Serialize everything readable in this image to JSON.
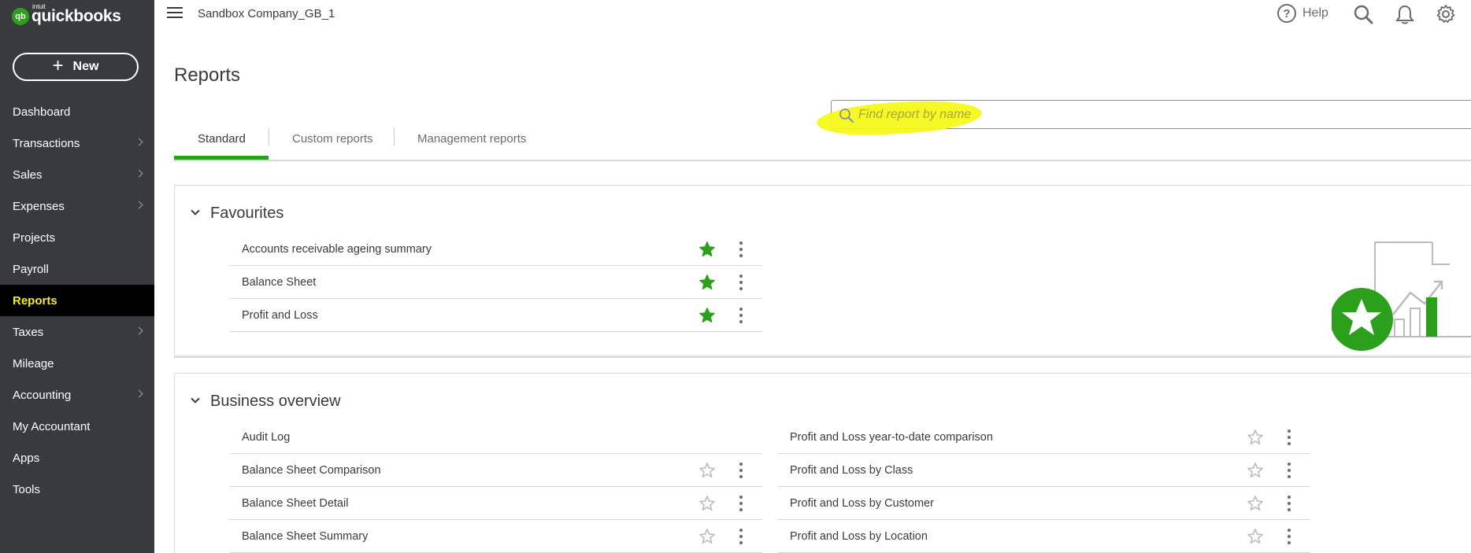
{
  "brand": {
    "badge": "qb",
    "intuit": "intuit",
    "name": "quickbooks",
    "accent": "#2ca01c"
  },
  "sidebar": {
    "new_label": "New",
    "new_plus": "+",
    "items": [
      {
        "label": "Dashboard",
        "chevron": false
      },
      {
        "label": "Transactions",
        "chevron": true
      },
      {
        "label": "Sales",
        "chevron": true
      },
      {
        "label": "Expenses",
        "chevron": true
      },
      {
        "label": "Projects",
        "chevron": false
      },
      {
        "label": "Payroll",
        "chevron": false
      },
      {
        "label": "Reports",
        "chevron": false,
        "active": true
      },
      {
        "label": "Taxes",
        "chevron": true
      },
      {
        "label": "Mileage",
        "chevron": false
      },
      {
        "label": "Accounting",
        "chevron": true
      },
      {
        "label": "My Accountant",
        "chevron": false
      },
      {
        "label": "Apps",
        "chevron": false
      },
      {
        "label": "Tools",
        "chevron": false
      }
    ]
  },
  "topbar": {
    "company": "Sandbox Company_GB_1",
    "help_icon_glyph": "?",
    "help_label": "Help",
    "icons": [
      "search-icon",
      "bell-icon",
      "gear-icon"
    ]
  },
  "page": {
    "title": "Reports"
  },
  "search": {
    "placeholder": "Find report by name"
  },
  "tabs": [
    {
      "label": "Standard",
      "active": true
    },
    {
      "label": "Custom reports",
      "active": false
    },
    {
      "label": "Management reports",
      "active": false
    }
  ],
  "favourites": {
    "title": "Favourites",
    "reports": [
      {
        "name": "Accounts receivable ageing summary",
        "starred": true
      },
      {
        "name": "Balance Sheet",
        "starred": true
      },
      {
        "name": "Profit and Loss",
        "starred": true
      }
    ]
  },
  "business_overview": {
    "title": "Business overview",
    "left": [
      {
        "name": "Audit Log",
        "starred": false,
        "actions": false
      },
      {
        "name": "Balance Sheet Comparison",
        "starred": false,
        "actions": true
      },
      {
        "name": "Balance Sheet Detail",
        "starred": false,
        "actions": true
      },
      {
        "name": "Balance Sheet Summary",
        "starred": false,
        "actions": true
      }
    ],
    "right": [
      {
        "name": "Profit and Loss year-to-date comparison",
        "starred": false,
        "actions": true
      },
      {
        "name": "Profit and Loss by Class",
        "starred": false,
        "actions": true
      },
      {
        "name": "Profit and Loss by Customer",
        "starred": false,
        "actions": true
      },
      {
        "name": "Profit and Loss by Location",
        "starred": false,
        "actions": true
      }
    ]
  }
}
